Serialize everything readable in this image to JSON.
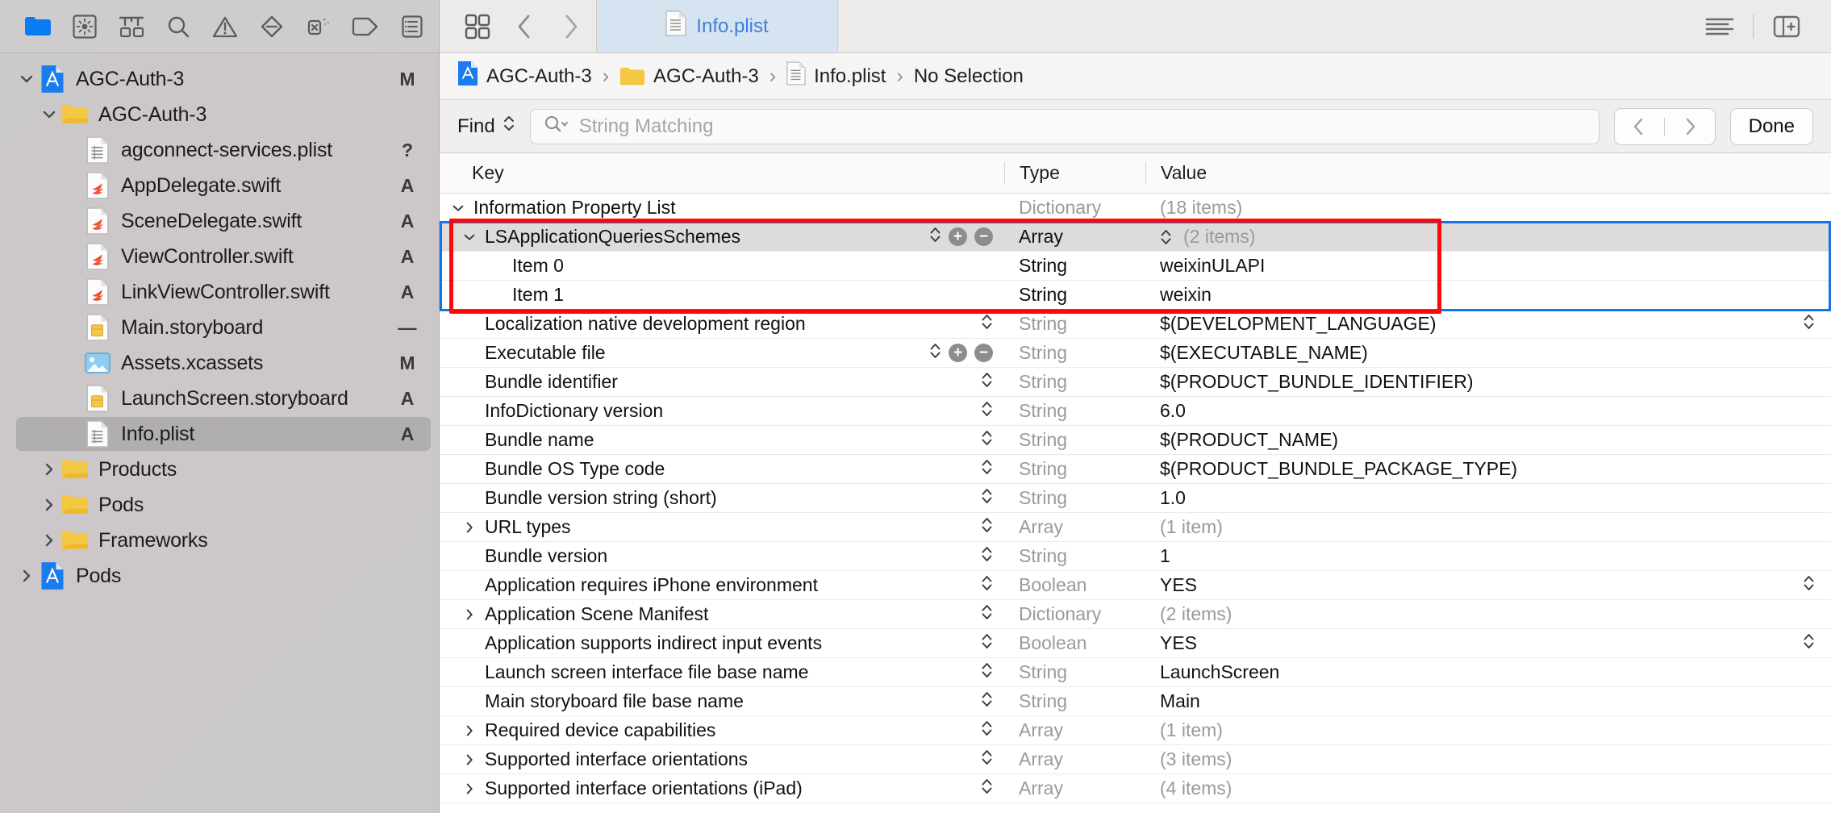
{
  "navigator": {
    "toolbar_icons": [
      "folder-icon",
      "source-control-icon",
      "hierarchy-icon",
      "search-icon",
      "warning-icon",
      "breakpoint-icon",
      "debug-icon",
      "tag-icon",
      "report-icon"
    ],
    "items": [
      {
        "label": "AGC-Auth-3",
        "icon": "xcodeproj-icon",
        "indent": 0,
        "disclosure": "down",
        "status": "M",
        "selected": false
      },
      {
        "label": "AGC-Auth-3",
        "icon": "folder-icon",
        "indent": 1,
        "disclosure": "down",
        "status": "",
        "selected": false
      },
      {
        "label": "agconnect-services.plist",
        "icon": "plist-icon",
        "indent": 2,
        "disclosure": "none",
        "status": "?",
        "selected": false
      },
      {
        "label": "AppDelegate.swift",
        "icon": "swift-icon",
        "indent": 2,
        "disclosure": "none",
        "status": "A",
        "selected": false
      },
      {
        "label": "SceneDelegate.swift",
        "icon": "swift-icon",
        "indent": 2,
        "disclosure": "none",
        "status": "A",
        "selected": false
      },
      {
        "label": "ViewController.swift",
        "icon": "swift-icon",
        "indent": 2,
        "disclosure": "none",
        "status": "A",
        "selected": false
      },
      {
        "label": "LinkViewController.swift",
        "icon": "swift-icon",
        "indent": 2,
        "disclosure": "none",
        "status": "A",
        "selected": false
      },
      {
        "label": "Main.storyboard",
        "icon": "storyboard-icon",
        "indent": 2,
        "disclosure": "none",
        "status": "—",
        "selected": false
      },
      {
        "label": "Assets.xcassets",
        "icon": "assets-icon",
        "indent": 2,
        "disclosure": "none",
        "status": "M",
        "selected": false
      },
      {
        "label": "LaunchScreen.storyboard",
        "icon": "storyboard-icon",
        "indent": 2,
        "disclosure": "none",
        "status": "A",
        "selected": false
      },
      {
        "label": "Info.plist",
        "icon": "plist-icon",
        "indent": 2,
        "disclosure": "none",
        "status": "A",
        "selected": true
      },
      {
        "label": "Products",
        "icon": "folder-icon",
        "indent": 1,
        "disclosure": "right",
        "status": "",
        "selected": false
      },
      {
        "label": "Pods",
        "icon": "folder-icon",
        "indent": 1,
        "disclosure": "right",
        "status": "",
        "selected": false
      },
      {
        "label": "Frameworks",
        "icon": "folder-icon",
        "indent": 1,
        "disclosure": "right",
        "status": "",
        "selected": false
      },
      {
        "label": "Pods",
        "icon": "xcodeproj-icon",
        "indent": 0,
        "disclosure": "right",
        "status": "",
        "selected": false
      }
    ]
  },
  "tabbar": {
    "grid_icon": "tab-overview-icon",
    "back_icon": "chevron-left-icon",
    "forward_icon": "chevron-right-icon",
    "active_tab": "Info.plist",
    "right_icons": [
      "text-align-icon",
      "inspector-toggle-icon"
    ]
  },
  "breadcrumb": {
    "items": [
      "AGC-Auth-3",
      "AGC-Auth-3",
      "Info.plist",
      "No Selection"
    ],
    "separator": "›"
  },
  "findbar": {
    "mode_label": "Find",
    "placeholder": "String Matching",
    "search_icon": "magnifier-dropdown-icon",
    "prev_icon": "chevron-left-icon",
    "next_icon": "chevron-right-icon",
    "done_label": "Done"
  },
  "plist": {
    "columns": {
      "key": "Key",
      "type": "Type",
      "value": "Value"
    },
    "rows": [
      {
        "key": "Information Property List",
        "indent": 0,
        "disclosure": "down",
        "type": "Dictionary",
        "type_muted": true,
        "value": "(18 items)",
        "value_muted": true,
        "stepper": false,
        "plusminus": false,
        "value_stepper": false,
        "selected": false
      },
      {
        "key": "LSApplicationQueriesSchemes",
        "indent": 1,
        "disclosure": "down",
        "type": "Array",
        "type_muted": false,
        "value": "(2 items)",
        "value_muted": true,
        "stepper": true,
        "plusminus": true,
        "value_stepper": true,
        "selected": true
      },
      {
        "key": "Item 0",
        "indent": 2,
        "disclosure": "none",
        "type": "String",
        "type_muted": false,
        "value": "weixinULAPI",
        "value_muted": false,
        "stepper": false,
        "plusminus": false,
        "value_stepper": false,
        "selected": false
      },
      {
        "key": "Item 1",
        "indent": 2,
        "disclosure": "none",
        "type": "String",
        "type_muted": false,
        "value": "weixin",
        "value_muted": false,
        "stepper": false,
        "plusminus": false,
        "value_stepper": false,
        "selected": false
      },
      {
        "key": "Localization native development region",
        "indent": 1,
        "disclosure": "none",
        "type": "String",
        "type_muted": true,
        "value": "$(DEVELOPMENT_LANGUAGE)",
        "value_muted": false,
        "stepper": true,
        "plusminus": false,
        "value_stepper": true,
        "selected": false
      },
      {
        "key": "Executable file",
        "indent": 1,
        "disclosure": "none",
        "type": "String",
        "type_muted": true,
        "value": "$(EXECUTABLE_NAME)",
        "value_muted": false,
        "stepper": true,
        "plusminus": true,
        "value_stepper": false,
        "selected": false
      },
      {
        "key": "Bundle identifier",
        "indent": 1,
        "disclosure": "none",
        "type": "String",
        "type_muted": true,
        "value": "$(PRODUCT_BUNDLE_IDENTIFIER)",
        "value_muted": false,
        "stepper": true,
        "plusminus": false,
        "value_stepper": false,
        "selected": false
      },
      {
        "key": "InfoDictionary version",
        "indent": 1,
        "disclosure": "none",
        "type": "String",
        "type_muted": true,
        "value": "6.0",
        "value_muted": false,
        "stepper": true,
        "plusminus": false,
        "value_stepper": false,
        "selected": false
      },
      {
        "key": "Bundle name",
        "indent": 1,
        "disclosure": "none",
        "type": "String",
        "type_muted": true,
        "value": "$(PRODUCT_NAME)",
        "value_muted": false,
        "stepper": true,
        "plusminus": false,
        "value_stepper": false,
        "selected": false
      },
      {
        "key": "Bundle OS Type code",
        "indent": 1,
        "disclosure": "none",
        "type": "String",
        "type_muted": true,
        "value": "$(PRODUCT_BUNDLE_PACKAGE_TYPE)",
        "value_muted": false,
        "stepper": true,
        "plusminus": false,
        "value_stepper": false,
        "selected": false
      },
      {
        "key": "Bundle version string (short)",
        "indent": 1,
        "disclosure": "none",
        "type": "String",
        "type_muted": true,
        "value": "1.0",
        "value_muted": false,
        "stepper": true,
        "plusminus": false,
        "value_stepper": false,
        "selected": false
      },
      {
        "key": "URL types",
        "indent": 1,
        "disclosure": "right",
        "type": "Array",
        "type_muted": true,
        "value": "(1 item)",
        "value_muted": true,
        "stepper": true,
        "plusminus": false,
        "value_stepper": false,
        "selected": false
      },
      {
        "key": "Bundle version",
        "indent": 1,
        "disclosure": "none",
        "type": "String",
        "type_muted": true,
        "value": "1",
        "value_muted": false,
        "stepper": true,
        "plusminus": false,
        "value_stepper": false,
        "selected": false
      },
      {
        "key": "Application requires iPhone environment",
        "indent": 1,
        "disclosure": "none",
        "type": "Boolean",
        "type_muted": true,
        "value": "YES",
        "value_muted": false,
        "stepper": true,
        "plusminus": false,
        "value_stepper": true,
        "selected": false
      },
      {
        "key": "Application Scene Manifest",
        "indent": 1,
        "disclosure": "right",
        "type": "Dictionary",
        "type_muted": true,
        "value": "(2 items)",
        "value_muted": true,
        "stepper": true,
        "plusminus": false,
        "value_stepper": false,
        "selected": false
      },
      {
        "key": "Application supports indirect input events",
        "indent": 1,
        "disclosure": "none",
        "type": "Boolean",
        "type_muted": true,
        "value": "YES",
        "value_muted": false,
        "stepper": true,
        "plusminus": false,
        "value_stepper": true,
        "selected": false
      },
      {
        "key": "Launch screen interface file base name",
        "indent": 1,
        "disclosure": "none",
        "type": "String",
        "type_muted": true,
        "value": "LaunchScreen",
        "value_muted": false,
        "stepper": true,
        "plusminus": false,
        "value_stepper": false,
        "selected": false
      },
      {
        "key": "Main storyboard file base name",
        "indent": 1,
        "disclosure": "none",
        "type": "String",
        "type_muted": true,
        "value": "Main",
        "value_muted": false,
        "stepper": true,
        "plusminus": false,
        "value_stepper": false,
        "selected": false
      },
      {
        "key": "Required device capabilities",
        "indent": 1,
        "disclosure": "right",
        "type": "Array",
        "type_muted": true,
        "value": "(1 item)",
        "value_muted": true,
        "stepper": true,
        "plusminus": false,
        "value_stepper": false,
        "selected": false
      },
      {
        "key": "Supported interface orientations",
        "indent": 1,
        "disclosure": "right",
        "type": "Array",
        "type_muted": true,
        "value": "(3 items)",
        "value_muted": true,
        "stepper": true,
        "plusminus": false,
        "value_stepper": false,
        "selected": false
      },
      {
        "key": "Supported interface orientations (iPad)",
        "indent": 1,
        "disclosure": "right",
        "type": "Array",
        "type_muted": true,
        "value": "(4 items)",
        "value_muted": true,
        "stepper": true,
        "plusminus": false,
        "value_stepper": false,
        "selected": false
      }
    ]
  },
  "annotation": {
    "highlight_color": "#fb0a07",
    "selection_color": "#1473e6"
  }
}
